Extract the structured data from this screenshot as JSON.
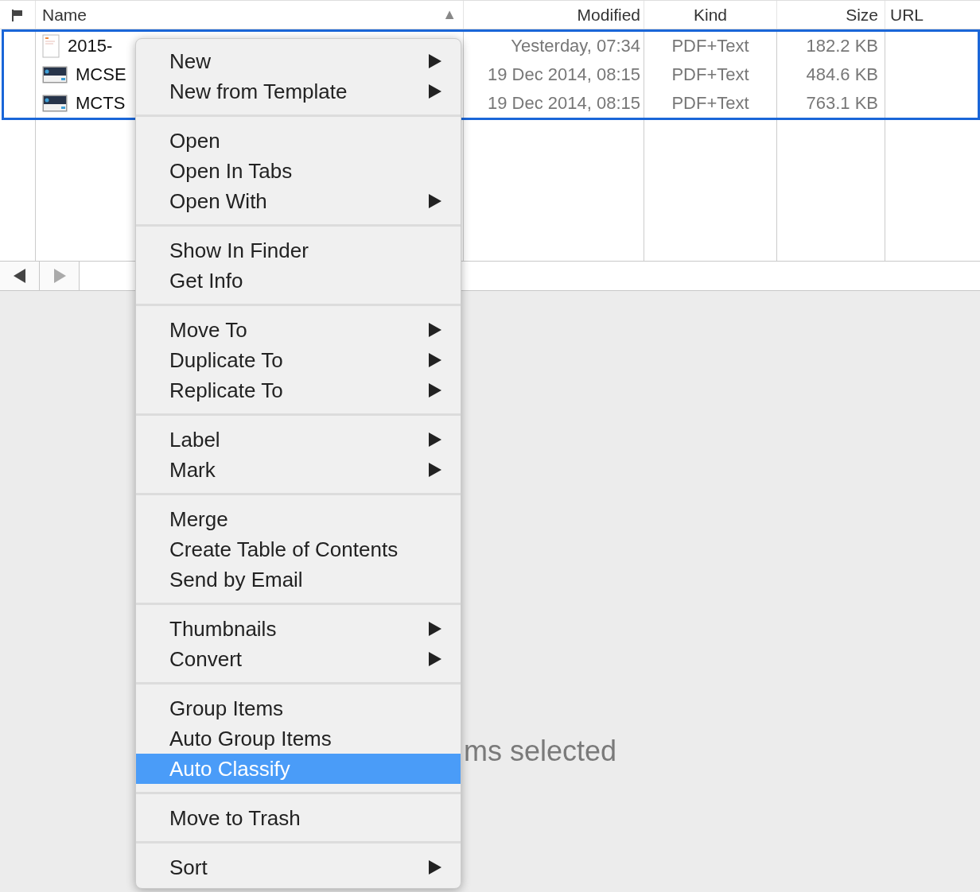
{
  "table": {
    "columns": [
      {
        "label": "Name",
        "sort_indicator": "▲"
      },
      {
        "label": "Modified"
      },
      {
        "label": "Kind"
      },
      {
        "label": "Size"
      },
      {
        "label": "URL"
      }
    ],
    "rows": [
      {
        "kind": "document",
        "name": "2015-",
        "modified": "Yesterday, 07:34",
        "file_kind": "PDF+Text",
        "size": "182.2 KB",
        "selected": true
      },
      {
        "kind": "screenshot",
        "name": "MCSE",
        "modified": "19 Dec 2014, 08:15",
        "file_kind": "PDF+Text",
        "size": "484.6 KB",
        "selected": true
      },
      {
        "kind": "screenshot",
        "name": "MCTS",
        "modified": "19 Dec 2014, 08:15",
        "file_kind": "PDF+Text",
        "size": "763.1 KB",
        "selected": true
      }
    ]
  },
  "status_text": "ms selected",
  "context_menu": [
    [
      {
        "label": "New",
        "submenu": true,
        "selected": false
      },
      {
        "label": "New from Template",
        "submenu": true,
        "selected": false
      }
    ],
    [
      {
        "label": "Open",
        "submenu": false,
        "selected": false
      },
      {
        "label": "Open In Tabs",
        "submenu": false,
        "selected": false
      },
      {
        "label": "Open With",
        "submenu": true,
        "selected": false
      }
    ],
    [
      {
        "label": "Show In Finder",
        "submenu": false,
        "selected": false
      },
      {
        "label": "Get Info",
        "submenu": false,
        "selected": false
      }
    ],
    [
      {
        "label": "Move To",
        "submenu": true,
        "selected": false
      },
      {
        "label": "Duplicate To",
        "submenu": true,
        "selected": false
      },
      {
        "label": "Replicate To",
        "submenu": true,
        "selected": false
      }
    ],
    [
      {
        "label": "Label",
        "submenu": true,
        "selected": false
      },
      {
        "label": "Mark",
        "submenu": true,
        "selected": false
      }
    ],
    [
      {
        "label": "Merge",
        "submenu": false,
        "selected": false
      },
      {
        "label": "Create Table of Contents",
        "submenu": false,
        "selected": false
      },
      {
        "label": "Send by Email",
        "submenu": false,
        "selected": false
      }
    ],
    [
      {
        "label": "Thumbnails",
        "submenu": true,
        "selected": false
      },
      {
        "label": "Convert",
        "submenu": true,
        "selected": false
      }
    ],
    [
      {
        "label": "Group Items",
        "submenu": false,
        "selected": false
      },
      {
        "label": "Auto Group Items",
        "submenu": false,
        "selected": false
      },
      {
        "label": "Auto Classify",
        "submenu": false,
        "selected": true
      }
    ],
    [
      {
        "label": "Move to Trash",
        "submenu": false,
        "selected": false
      }
    ],
    [
      {
        "label": "Sort",
        "submenu": true,
        "selected": false
      }
    ]
  ]
}
